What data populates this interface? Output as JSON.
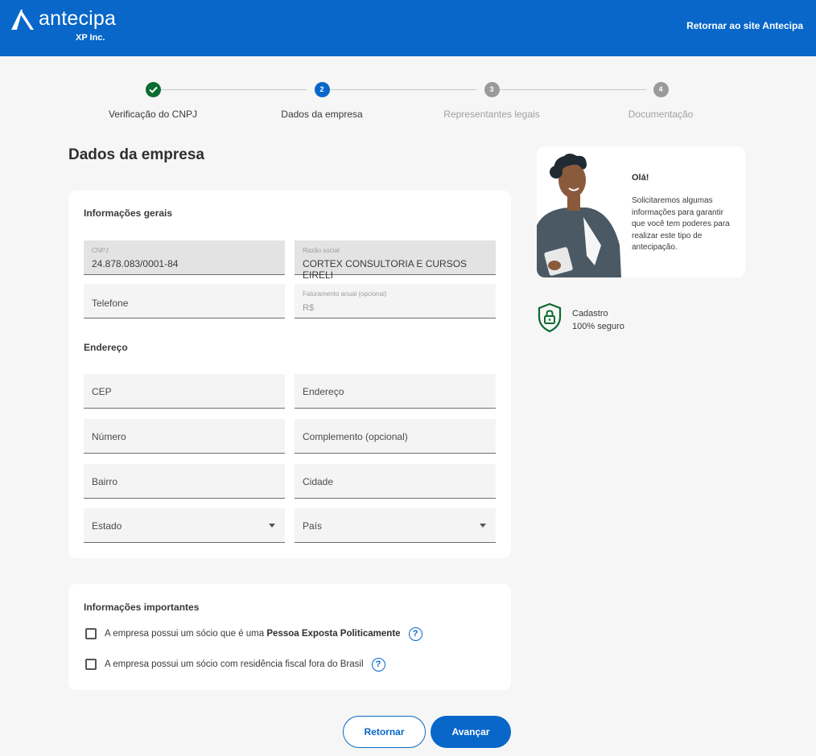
{
  "header": {
    "logo_text": "antecipa",
    "logo_sub": "XP Inc.",
    "return_link": "Retornar ao site Antecipa",
    "brand_color": "#0867c8"
  },
  "stepper": {
    "steps": [
      {
        "number": "1",
        "label": "Verificação do CNPJ",
        "status": "done"
      },
      {
        "number": "2",
        "label": "Dados da empresa",
        "status": "active"
      },
      {
        "number": "3",
        "label": "Representantes legais",
        "status": "todo"
      },
      {
        "number": "4",
        "label": "Documentação",
        "status": "todo"
      }
    ]
  },
  "page": {
    "title": "Dados da empresa"
  },
  "general": {
    "title": "Informações gerais",
    "cnpj_label": "CNPJ",
    "cnpj_value": "24.878.083/0001-84",
    "razao_label": "Razão social",
    "razao_value": "CORTEX CONSULTORIA E CURSOS EIRELI",
    "telefone_placeholder": "Telefone",
    "faturamento_label": "Faturamento anual (opcional)",
    "faturamento_prefix": "R$"
  },
  "address": {
    "title": "Endereço",
    "cep": "CEP",
    "endereco": "Endereço",
    "numero": "Número",
    "complemento": "Complemento (opcional)",
    "bairro": "Bairro",
    "cidade": "Cidade",
    "estado": "Estado",
    "pais": "País"
  },
  "important": {
    "title": "Informações importantes",
    "check1_prefix": "A empresa possui um sócio que é uma",
    "check1_bold": "Pessoa Exposta Politicamente",
    "check2": "A empresa possui um sócio com residência fiscal fora do Brasil",
    "help_glyph": "?"
  },
  "actions": {
    "back": "Retornar",
    "next": "Avançar"
  },
  "hello": {
    "title": "Olá!",
    "text": "Solicitaremos algumas informações para garantir que você tem poderes para realizar este tipo de antecipação."
  },
  "secure": {
    "line1": "Cadastro",
    "line2": "100% seguro",
    "icon": "shield-lock-icon",
    "color": "#0c6b2f"
  }
}
